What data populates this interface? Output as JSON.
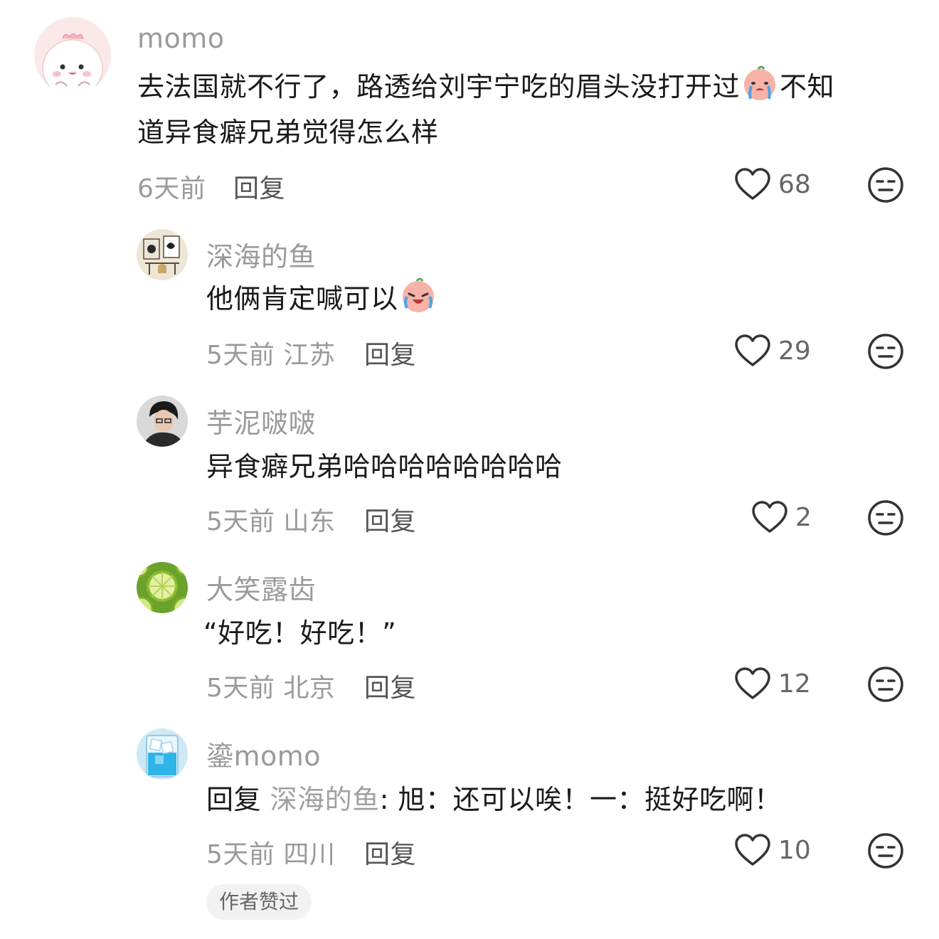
{
  "comments": [
    {
      "user": "momo",
      "text_a": "去法国就不行了，路透给刘宇宁吃的眉头没打开过",
      "text_b": "不知",
      "text_c": "道异食癖兄弟觉得怎么样",
      "time": "6天前",
      "location": "",
      "reply_label": "回复",
      "likes": "68",
      "avatar_icon": "pink-dino-avatar"
    },
    {
      "user": "深海的鱼",
      "text": "他俩肯定喊可以",
      "time": "5天前",
      "location": "江苏",
      "reply_label": "回复",
      "likes": "29",
      "avatar_icon": "cat-sketch-avatar"
    },
    {
      "user": "芋泥啵啵",
      "text": "异食癖兄弟哈哈哈哈哈哈哈哈",
      "time": "5天前",
      "location": "山东",
      "reply_label": "回复",
      "likes": "2",
      "avatar_icon": "person-photo-avatar"
    },
    {
      "user": "大笑露齿",
      "text": "“好吃！好吃！”",
      "time": "5天前",
      "location": "北京",
      "reply_label": "回复",
      "likes": "12",
      "avatar_icon": "lime-slices-avatar"
    },
    {
      "user": "鎏momo",
      "reply_prefix": "回复",
      "reply_target": "深海的鱼",
      "text": ": 旭：还可以唉！一：挺好吃啊！",
      "time": "5天前",
      "location": "四川",
      "reply_label": "回复",
      "likes": "10",
      "avatar_icon": "blue-drink-avatar"
    }
  ],
  "author_badge": "作者赞过",
  "colors": {
    "username": "#9a9a9a",
    "text": "#1a1a1a",
    "meta": "#9a9a9a",
    "badge_bg": "#f2f2f2"
  }
}
